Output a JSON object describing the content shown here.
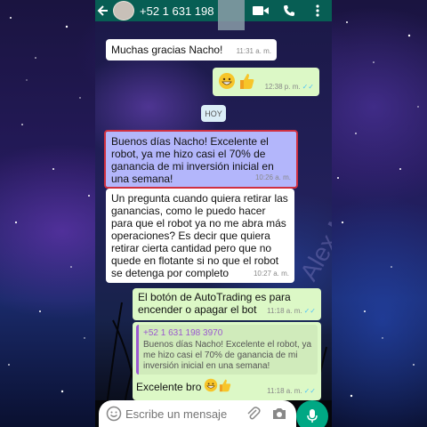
{
  "header": {
    "back_icon": "arrow-left-icon",
    "contact_phone": "+52 1 631 198",
    "video_icon": "video-camera-icon",
    "call_icon": "phone-icon",
    "menu_icon": "more-vert-icon",
    "color": "#075e54"
  },
  "messages": [
    {
      "dir": "in",
      "text": "Muchas gracias Nacho!",
      "time": "11:31 a. m."
    },
    {
      "dir": "out",
      "emoji": "😁👍",
      "time": "12:38 p. m."
    },
    {
      "day_separator": "HOY"
    },
    {
      "dir": "in",
      "highlighted": true,
      "text": "Buenos días Nacho! Excelente el robot, ya me hizo casi el 70% de ganancia de mi inversión inicial en una semana!",
      "time": "10:26 a. m."
    },
    {
      "dir": "in",
      "text": "Un pregunta cuando quiera retirar las ganancias, como le puedo hacer para que el robot ya no me abra más operaciones? Es decir que quiera retirar cierta cantidad pero que no quede en flotante si no que el robot se detenga por completo",
      "time": "10:27 a. m."
    },
    {
      "dir": "out",
      "text": "El botón de AutoTrading es para encender o apagar el bot",
      "time": "11:18 a. m."
    },
    {
      "dir": "out",
      "quote_name": "+52 1 631 198 3970",
      "quote_text": "Buenos días Nacho! Excelente el robot, ya me hizo casi el 70% de ganancia de mi inversión inicial en una semana!",
      "text": "Excelente bro",
      "emoji": "😁👍",
      "time": "11:18 a. m."
    }
  ],
  "watermark": "Alex Marty",
  "composer": {
    "placeholder": "Escribe un mensaje",
    "emoji_icon": "emoji-smile-icon",
    "attach_icon": "paperclip-icon",
    "camera_icon": "camera-icon",
    "mic_icon": "microphone-icon",
    "mic_color": "#00a884"
  },
  "colors": {
    "incoming": "#ffffff",
    "outgoing": "#dcf8c6",
    "highlight_fill": "#b3b6fb",
    "highlight_border": "#d03040",
    "read_ticks": "#4fc3f7"
  }
}
